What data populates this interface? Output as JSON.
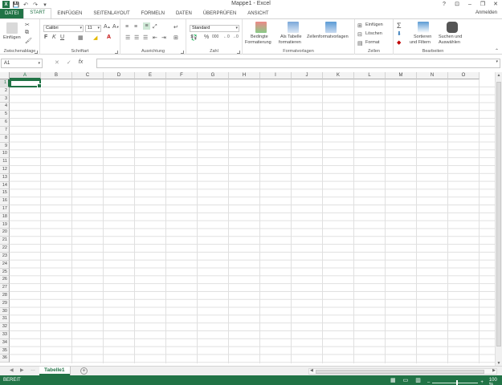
{
  "window": {
    "title": "Mappe1 - Excel",
    "controls": {
      "help": "?",
      "ribbon_display": "⊡",
      "minimize": "–",
      "restore": "❐",
      "close": "✕"
    },
    "qat": {
      "logo": "X",
      "save": "💾",
      "undo": "↶",
      "redo": "↷",
      "customize": "▾"
    }
  },
  "tabs": [
    "DATEI",
    "START",
    "EINFÜGEN",
    "SEITENLAYOUT",
    "FORMELN",
    "DATEN",
    "ÜBERPRÜFEN",
    "ANSICHT"
  ],
  "active_tab": "START",
  "user": "Anmelden",
  "ribbon": {
    "clipboard": {
      "label": "Zwischenablage",
      "paste": "Einfügen"
    },
    "font": {
      "label": "Schriftart",
      "font_name": "Calibri",
      "font_size": "11",
      "bold": "F",
      "italic": "K",
      "underline": "U"
    },
    "alignment": {
      "label": "Ausrichtung"
    },
    "number": {
      "label": "Zahl",
      "format": "Standard",
      "percent": "%",
      "thousands": "000"
    },
    "styles": {
      "label": "Formatvorlagen",
      "conditional_line1": "Bedingte",
      "conditional_line2": "Formatierung",
      "table_line1": "Als Tabelle",
      "table_line2": "formatieren",
      "cellstyles": "Zellenformatvorlagen"
    },
    "cells": {
      "label": "Zellen",
      "insert": "Einfügen",
      "delete": "Löschen",
      "format": "Format"
    },
    "editing": {
      "label": "Bearbeiten",
      "sort_line1": "Sortieren",
      "sort_line2": "und Filtern",
      "find_line1": "Suchen und",
      "find_line2": "Auswählen"
    }
  },
  "formula_bar": {
    "name_box": "A1",
    "cancel": "✕",
    "enter": "✓",
    "fx": "fx",
    "value": ""
  },
  "grid": {
    "columns": [
      "A",
      "B",
      "C",
      "D",
      "E",
      "F",
      "G",
      "H",
      "I",
      "J",
      "K",
      "L",
      "M",
      "N",
      "O"
    ],
    "rows": [
      "1",
      "2",
      "3",
      "4",
      "5",
      "6",
      "7",
      "8",
      "9",
      "10",
      "11",
      "12",
      "13",
      "14",
      "15",
      "16",
      "17",
      "18",
      "19",
      "20",
      "21",
      "22",
      "23",
      "24",
      "25",
      "26",
      "27",
      "28",
      "29",
      "30",
      "31",
      "32",
      "33",
      "34",
      "35",
      "36"
    ],
    "active_cell": "A1"
  },
  "sheets": {
    "tabs": [
      "Tabelle1"
    ],
    "active": "Tabelle1",
    "add": "+"
  },
  "status": {
    "text": "BEREIT",
    "zoom": "100 %",
    "zoom_minus": "–",
    "zoom_plus": "+"
  },
  "colors": {
    "accent": "#217346",
    "header_bg": "#f3f3f3",
    "gridline": "#e0e0e0"
  }
}
